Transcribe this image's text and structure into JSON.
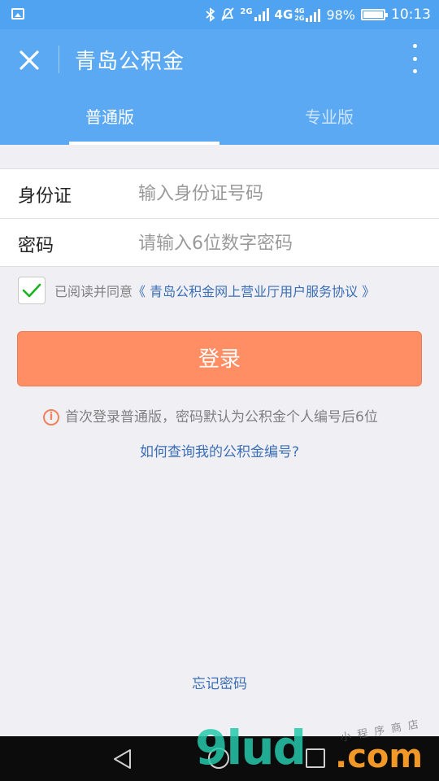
{
  "status_bar": {
    "network_2g": "2G",
    "network_4g": "4G",
    "network_4g_small": "4G",
    "network_2g_small": "2G",
    "battery": "98%",
    "time": "10:13"
  },
  "app_bar": {
    "title": "青岛公积金"
  },
  "tabs": [
    {
      "label": "普通版"
    },
    {
      "label": "专业版"
    }
  ],
  "form": {
    "id_label": "身份证",
    "id_placeholder": "输入身份证号码",
    "id_value": "",
    "password_label": "密码",
    "password_placeholder": "请输入6位数字密码",
    "password_value": ""
  },
  "agreement": {
    "checked": true,
    "text": "已阅读并同意",
    "link": "《 青岛公积金网上营业厅用户服务协议 》"
  },
  "login_button": "登录",
  "tip": {
    "icon": "i",
    "text": "首次登录普通版，密码默认为公积金个人编号后6位"
  },
  "help_link": "如何查询我的公积金编号?",
  "forgot_link": "忘记密码",
  "watermark": {
    "main": "9lud",
    "domain": ".com",
    "small": "小程序商店"
  },
  "colors": {
    "primary": "#5aa9f2",
    "login_button": "#ff8e64",
    "link": "#3b6fb6",
    "check": "#19b320"
  }
}
